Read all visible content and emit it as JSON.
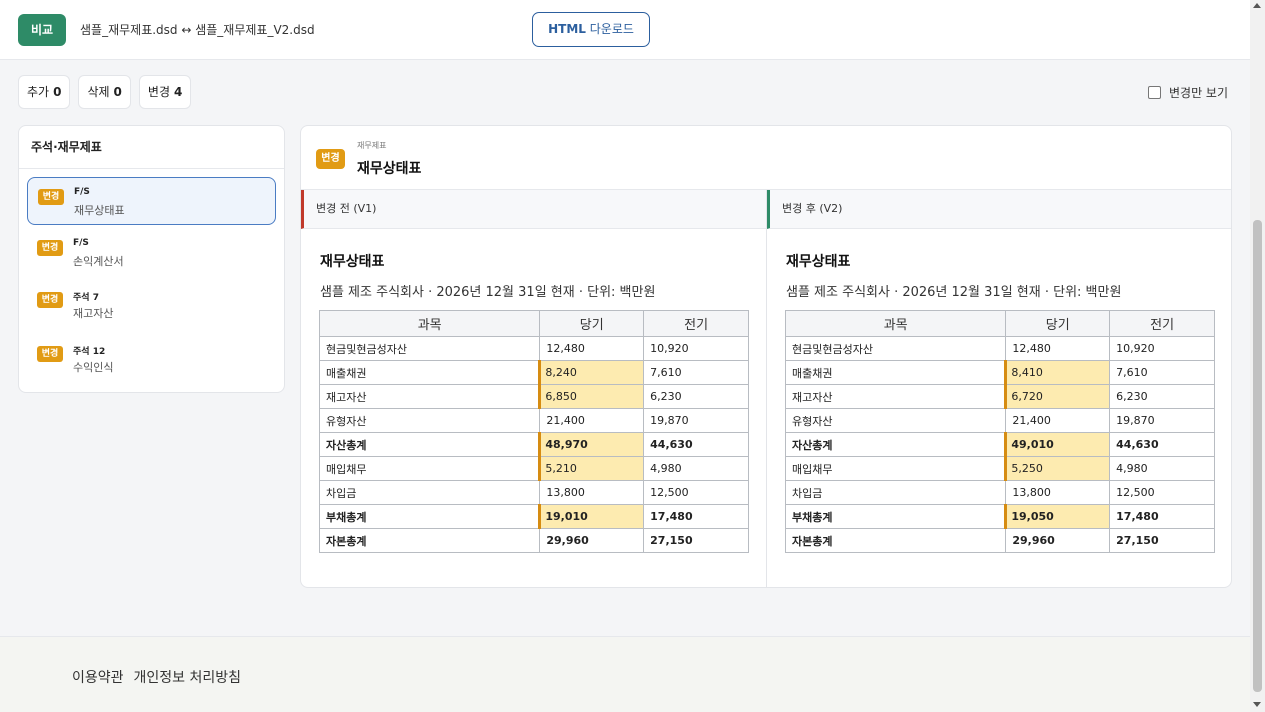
{
  "header": {
    "compare_badge": "비교",
    "file_title": "샘플_재무제표.dsd ↔ 샘플_재무제표_V2.dsd",
    "download_bold": "HTML",
    "download_rest": " 다운로드"
  },
  "filters": {
    "added_label": "추가",
    "added_count": "0",
    "deleted_label": "삭제",
    "deleted_count": "0",
    "changed_label": "변경",
    "changed_count": "4",
    "only_changed_label": "변경만 보기"
  },
  "sidebar": {
    "title": "주석·재무제표",
    "items": [
      {
        "tag": "변경",
        "code": "F/S",
        "name": "재무상태표"
      },
      {
        "tag": "변경",
        "code": "F/S",
        "name": "손익계산서"
      },
      {
        "tag": "변경",
        "code": "주석 7",
        "name": "재고자산"
      },
      {
        "tag": "변경",
        "code": "주석 12",
        "name": "수익인식"
      }
    ]
  },
  "panel": {
    "tag": "변경",
    "crumb": "재무제표",
    "title": "재무상태표",
    "before": {
      "header": "변경 전 (V1)",
      "doc_title": "재무상태표",
      "doc_sub": "샘플 제조 주식회사 · 2026년 12월 31일 현재 · 단위: 백만원"
    },
    "after": {
      "header": "변경 후 (V2)",
      "doc_title": "재무상태표",
      "doc_sub": "샘플 제조 주식회사 · 2026년 12월 31일 현재 · 단위: 백만원"
    },
    "columns": [
      "과목",
      "당기",
      "전기"
    ],
    "rows_before": [
      {
        "item": "현금및현금성자산",
        "cur": "12,480",
        "prev": "10,920",
        "changed": false,
        "total": false
      },
      {
        "item": "매출채권",
        "cur": "8,240",
        "prev": "7,610",
        "changed": true,
        "total": false
      },
      {
        "item": "재고자산",
        "cur": "6,850",
        "prev": "6,230",
        "changed": true,
        "total": false
      },
      {
        "item": "유형자산",
        "cur": "21,400",
        "prev": "19,870",
        "changed": false,
        "total": false
      },
      {
        "item": "자산총계",
        "cur": "48,970",
        "prev": "44,630",
        "changed": true,
        "total": true
      },
      {
        "item": "매입채무",
        "cur": "5,210",
        "prev": "4,980",
        "changed": true,
        "total": false
      },
      {
        "item": "차입금",
        "cur": "13,800",
        "prev": "12,500",
        "changed": false,
        "total": false
      },
      {
        "item": "부채총계",
        "cur": "19,010",
        "prev": "17,480",
        "changed": true,
        "total": true
      },
      {
        "item": "자본총계",
        "cur": "29,960",
        "prev": "27,150",
        "changed": false,
        "total": true
      }
    ],
    "rows_after": [
      {
        "item": "현금및현금성자산",
        "cur": "12,480",
        "prev": "10,920",
        "changed": false,
        "total": false
      },
      {
        "item": "매출채권",
        "cur": "8,410",
        "prev": "7,610",
        "changed": true,
        "total": false
      },
      {
        "item": "재고자산",
        "cur": "6,720",
        "prev": "6,230",
        "changed": true,
        "total": false
      },
      {
        "item": "유형자산",
        "cur": "21,400",
        "prev": "19,870",
        "changed": false,
        "total": false
      },
      {
        "item": "자산총계",
        "cur": "49,010",
        "prev": "44,630",
        "changed": true,
        "total": true
      },
      {
        "item": "매입채무",
        "cur": "5,250",
        "prev": "4,980",
        "changed": true,
        "total": false
      },
      {
        "item": "차입금",
        "cur": "13,800",
        "prev": "12,500",
        "changed": false,
        "total": false
      },
      {
        "item": "부채총계",
        "cur": "19,050",
        "prev": "17,480",
        "changed": true,
        "total": true
      },
      {
        "item": "자본총계",
        "cur": "29,960",
        "prev": "27,150",
        "changed": false,
        "total": true
      }
    ]
  },
  "footer": {
    "terms": "이용약관",
    "privacy": "개인정보 처리방침"
  },
  "colors": {
    "accent_green": "#2e8b67",
    "accent_blue": "#2c5f9e",
    "changed_tag": "#e19b14",
    "changed_cell": "#fdebb0",
    "before_marker": "#c0392b"
  }
}
